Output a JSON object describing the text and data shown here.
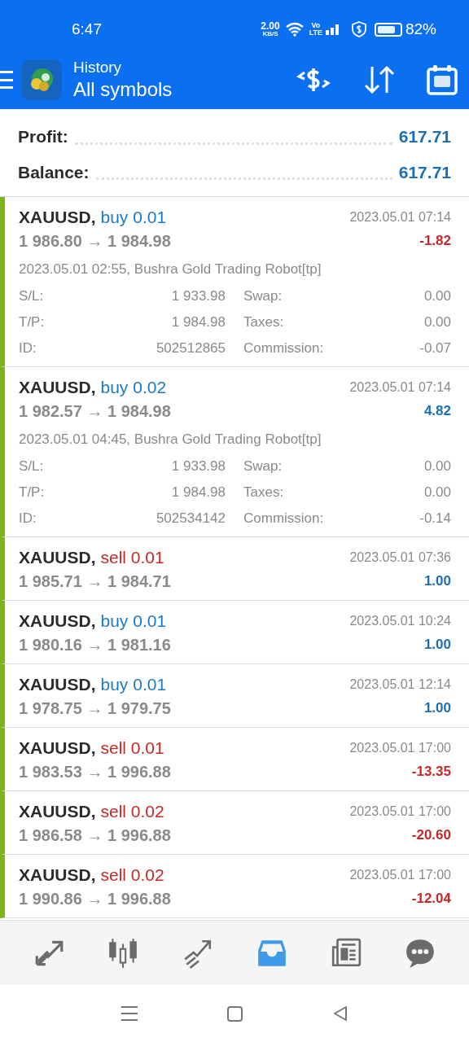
{
  "status_bar": {
    "time": "6:47",
    "speed": "2.00",
    "speed_unit": "KB/S",
    "network_top": "Vo",
    "network_bottom": "LTE",
    "battery": "82%"
  },
  "header": {
    "title": "History",
    "subtitle": "All symbols"
  },
  "summary": [
    {
      "label": "Profit:",
      "value": "617.71"
    },
    {
      "label": "Balance:",
      "value": "617.71"
    }
  ],
  "deals": [
    {
      "symbol": "XAUUSD,",
      "sell": false,
      "order": "buy 0.01",
      "time": "2023.05.01 07:14",
      "prices": "1 986.80 → 1 984.98",
      "profit": "-1.82",
      "loss": true,
      "expanded": true,
      "comment": "2023.05.01 02:55, Bushra Gold Trading Robot[tp]",
      "details": [
        [
          "S/L:",
          "1 933.98",
          "Swap:",
          "0.00"
        ],
        [
          "T/P:",
          "1 984.98",
          "Taxes:",
          "0.00"
        ],
        [
          "ID:",
          "502512865",
          "Commission:",
          "-0.07"
        ]
      ]
    },
    {
      "symbol": "XAUUSD,",
      "sell": false,
      "order": "buy 0.02",
      "time": "2023.05.01 07:14",
      "prices": "1 982.57 → 1 984.98",
      "profit": "4.82",
      "loss": false,
      "expanded": true,
      "comment": "2023.05.01 04:45, Bushra Gold Trading Robot[tp]",
      "details": [
        [
          "S/L:",
          "1 933.98",
          "Swap:",
          "0.00"
        ],
        [
          "T/P:",
          "1 984.98",
          "Taxes:",
          "0.00"
        ],
        [
          "ID:",
          "502534142",
          "Commission:",
          "-0.14"
        ]
      ]
    },
    {
      "symbol": "XAUUSD,",
      "sell": true,
      "order": "sell 0.01",
      "time": "2023.05.01 07:36",
      "prices": "1 985.71 → 1 984.71",
      "profit": "1.00",
      "loss": false,
      "expanded": false
    },
    {
      "symbol": "XAUUSD,",
      "sell": false,
      "order": "buy 0.01",
      "time": "2023.05.01 10:24",
      "prices": "1 980.16 → 1 981.16",
      "profit": "1.00",
      "loss": false,
      "expanded": false
    },
    {
      "symbol": "XAUUSD,",
      "sell": false,
      "order": "buy 0.01",
      "time": "2023.05.01 12:14",
      "prices": "1 978.75 → 1 979.75",
      "profit": "1.00",
      "loss": false,
      "expanded": false
    },
    {
      "symbol": "XAUUSD,",
      "sell": true,
      "order": "sell 0.01",
      "time": "2023.05.01 17:00",
      "prices": "1 983.53 → 1 996.88",
      "profit": "-13.35",
      "loss": true,
      "expanded": false
    },
    {
      "symbol": "XAUUSD,",
      "sell": true,
      "order": "sell 0.02",
      "time": "2023.05.01 17:00",
      "prices": "1 986.58 → 1 996.88",
      "profit": "-20.60",
      "loss": true,
      "expanded": false
    },
    {
      "symbol": "XAUUSD,",
      "sell": true,
      "order": "sell 0.02",
      "time": "2023.05.01 17:00",
      "prices": "1 990.86 → 1 996.88",
      "profit": "-12.04",
      "loss": true,
      "expanded": false
    }
  ],
  "bottom_nav": [
    {
      "kind": "trade",
      "selected": false
    },
    {
      "kind": "quotes",
      "selected": false
    },
    {
      "kind": "chart",
      "selected": false
    },
    {
      "kind": "history",
      "selected": true
    },
    {
      "kind": "news",
      "selected": false
    },
    {
      "kind": "chat",
      "selected": false
    }
  ]
}
